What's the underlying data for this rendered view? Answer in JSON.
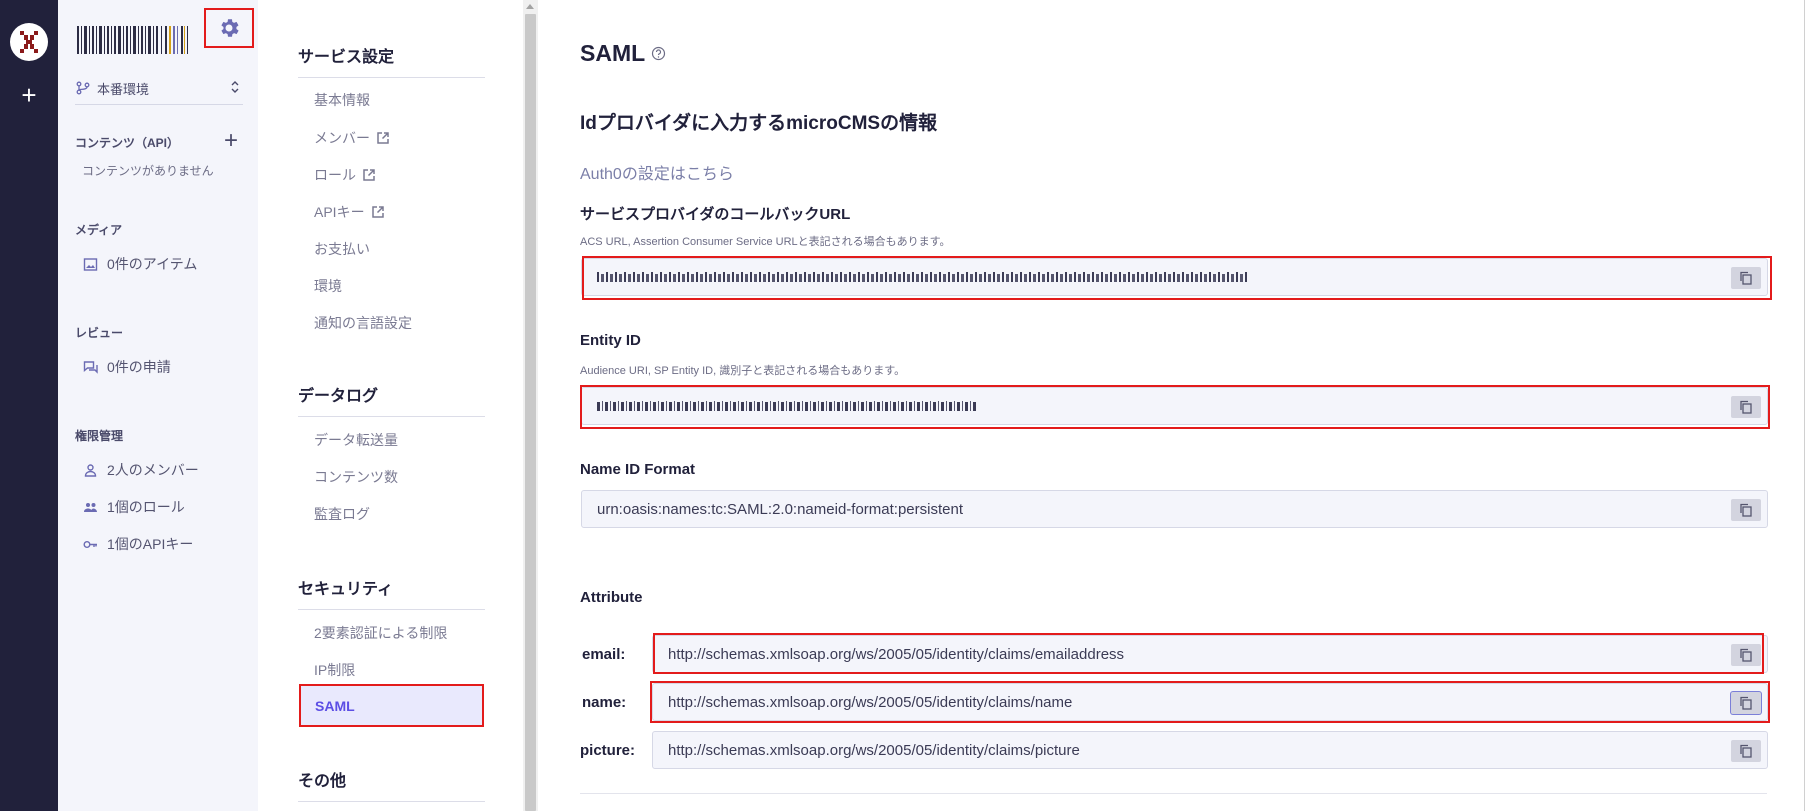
{
  "rail": {
    "logo_icon": "microcms-logo-icon",
    "add_icon": "plus-icon",
    "add_label": "+"
  },
  "sidebar": {
    "settings_icon": "gear-icon",
    "environment": "本番環境",
    "contents_heading": "コンテンツ（API）",
    "contents_add": "+",
    "contents_empty": "コンテンツがありません",
    "media_heading": "メディア",
    "media_items": "0件のアイテム",
    "review_heading": "レビュー",
    "review_items": "0件の申請",
    "perm_heading": "権限管理",
    "perm_members": "2人のメンバー",
    "perm_roles": "1個のロール",
    "perm_apikeys": "1個のAPIキー"
  },
  "settings": {
    "service_heading": "サービス設定",
    "basic": "基本情報",
    "members": "メンバー",
    "roles": "ロール",
    "apikeys": "APIキー",
    "payment": "お支払い",
    "environment": "環境",
    "notification_lang": "通知の言語設定",
    "datalog_heading": "データログ",
    "transfer": "データ転送量",
    "content_count": "コンテンツ数",
    "audit_log": "監査ログ",
    "security_heading": "セキュリティ",
    "twofa": "2要素認証による制限",
    "ip": "IP制限",
    "saml": "SAML",
    "other_heading": "その他"
  },
  "main": {
    "title": "SAML",
    "subtitle": "Idプロバイダに入力するmicroCMSの情報",
    "auth0_link": "Auth0の設定はこちら",
    "callback_label": "サービスプロバイダのコールバックURL",
    "callback_hint": "ACS URL, Assertion Consumer Service URLと表記される場合もあります。",
    "entity_label": "Entity ID",
    "entity_hint": "Audience URI, SP Entity ID, 識別子と表記される場合もあります。",
    "nameid_label": "Name ID Format",
    "nameid_value": "urn:oasis:names:tc:SAML:2.0:nameid-format:persistent",
    "attribute_heading": "Attribute",
    "attr_email_key": "email:",
    "attr_email_value": "http://schemas.xmlsoap.org/ws/2005/05/identity/claims/emailaddress",
    "attr_name_key": "name:",
    "attr_name_value": "http://schemas.xmlsoap.org/ws/2005/05/identity/claims/name",
    "attr_picture_key": "picture:",
    "attr_picture_value": "http://schemas.xmlsoap.org/ws/2005/05/identity/claims/picture"
  },
  "colors": {
    "rail": "#21213b",
    "accent": "#5c4ee5",
    "highlight_red": "#e31b1b",
    "sidebar_bg": "#f4f5fb"
  }
}
